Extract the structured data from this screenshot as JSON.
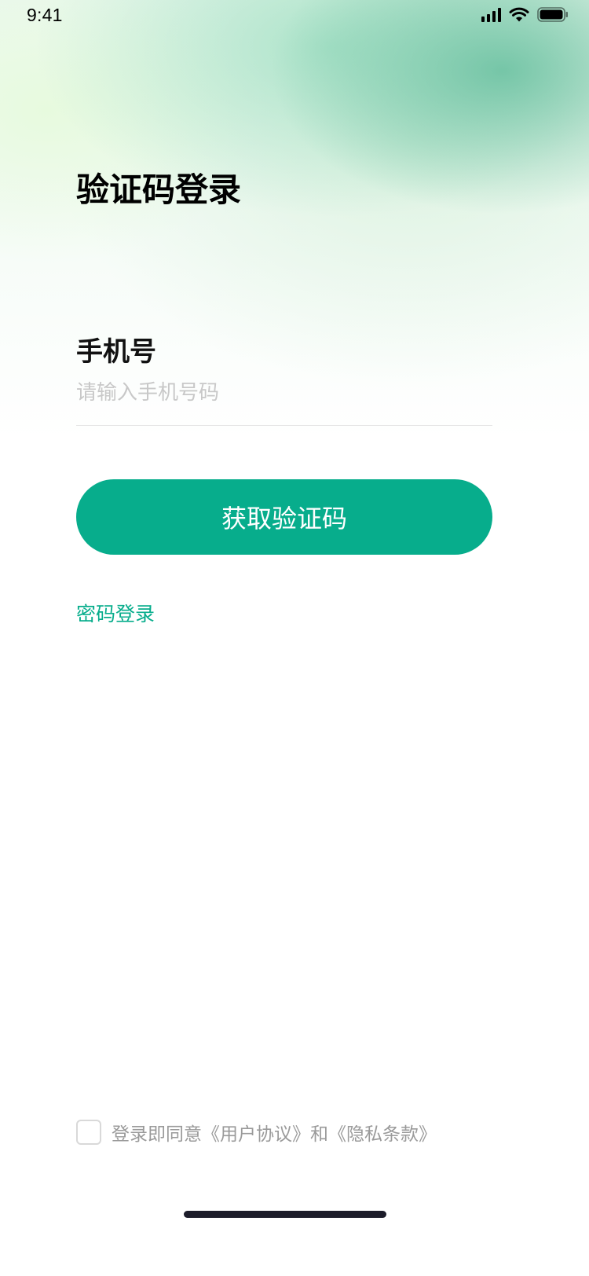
{
  "status_bar": {
    "time": "9:41",
    "icons": [
      "signal-icon",
      "wifi-icon",
      "battery-icon"
    ]
  },
  "header": {
    "title": "验证码登录"
  },
  "form": {
    "phone_label": "手机号",
    "phone_placeholder": "请输入手机号码",
    "phone_value": ""
  },
  "actions": {
    "get_code_label": "获取验证码",
    "password_login_label": "密码登录"
  },
  "agreement": {
    "checked": false,
    "text": "登录即同意《用户协议》和《隐私条款》"
  },
  "colors": {
    "accent": "#07ad8c",
    "placeholder": "#c8c8c8",
    "muted_text": "#9a9a9a"
  }
}
